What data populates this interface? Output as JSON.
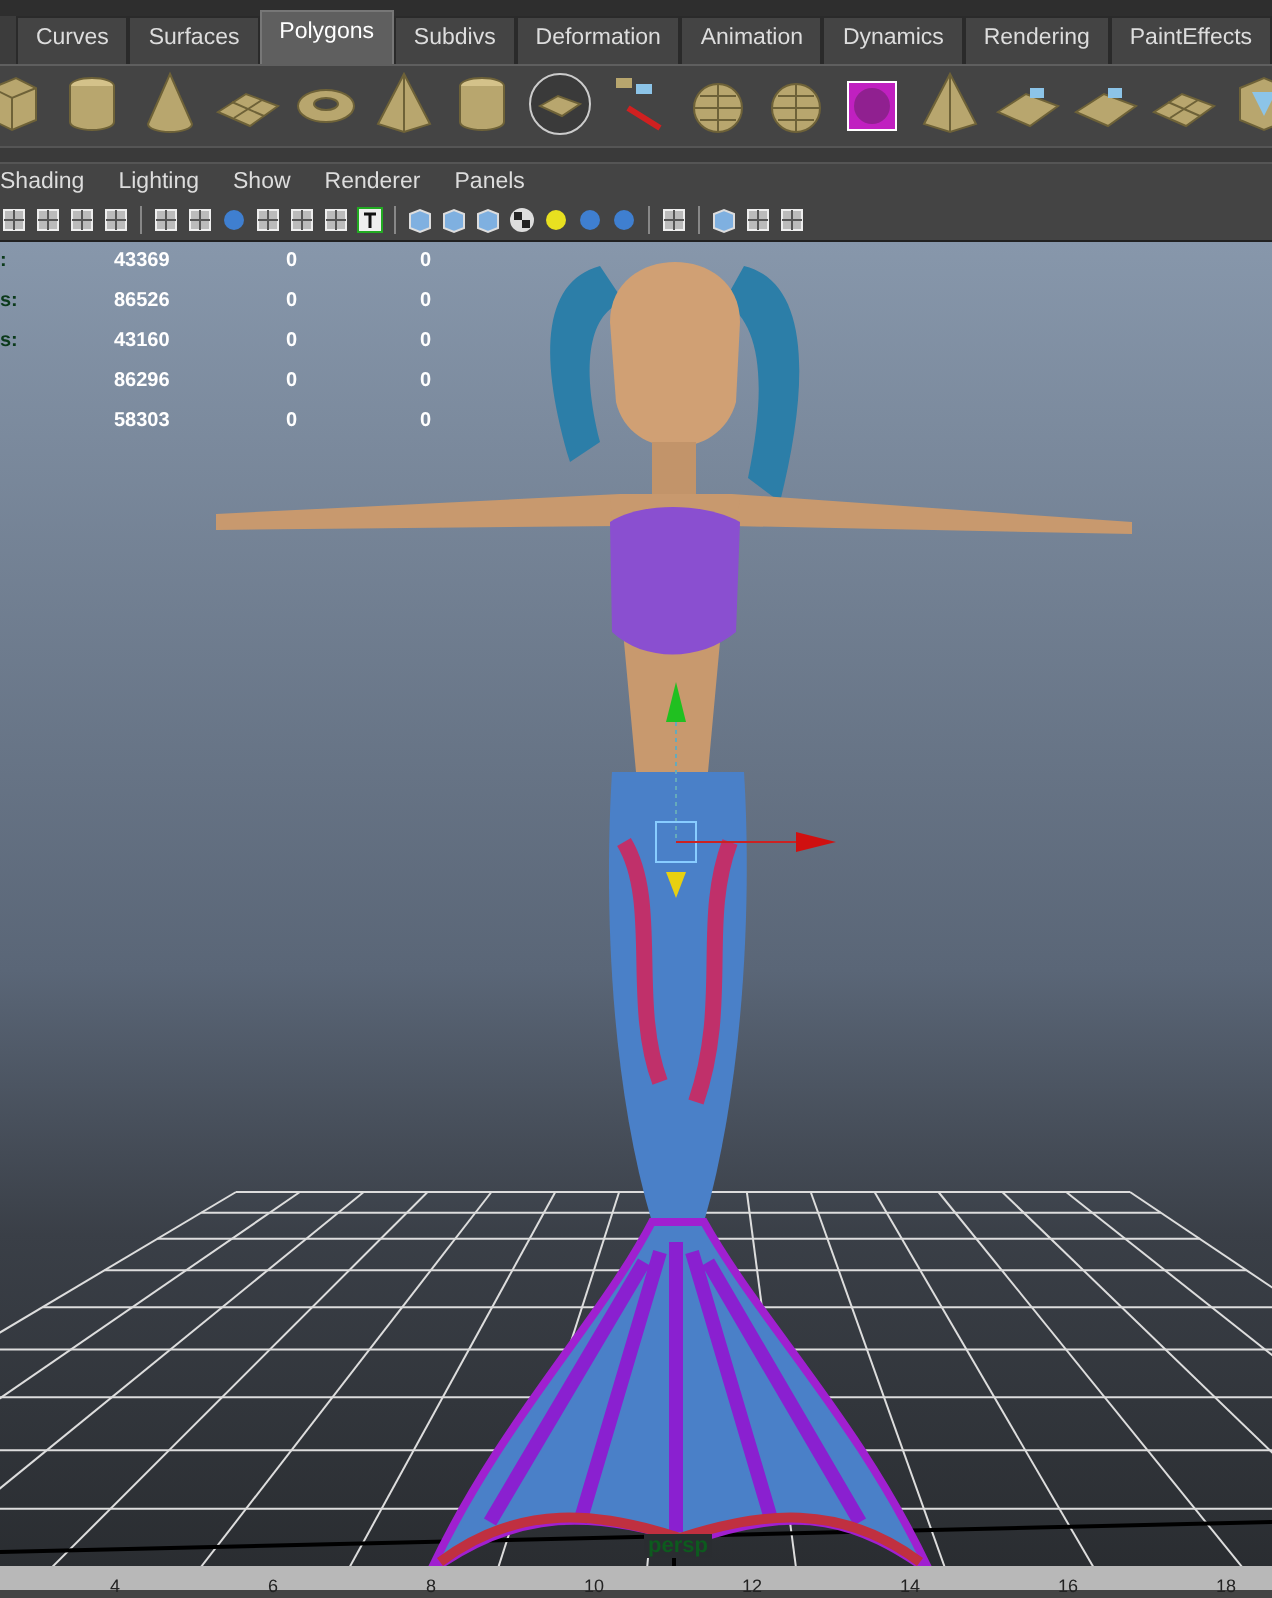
{
  "tabs": [
    {
      "label": "Curves",
      "selected": false
    },
    {
      "label": "Surfaces",
      "selected": false
    },
    {
      "label": "Polygons",
      "selected": true
    },
    {
      "label": "Subdivs",
      "selected": false
    },
    {
      "label": "Deformation",
      "selected": false
    },
    {
      "label": "Animation",
      "selected": false
    },
    {
      "label": "Dynamics",
      "selected": false
    },
    {
      "label": "Rendering",
      "selected": false
    },
    {
      "label": "PaintEffects",
      "selected": false
    }
  ],
  "panel_menu": [
    "Shading",
    "Lighting",
    "Show",
    "Renderer",
    "Panels"
  ],
  "stats": [
    {
      "label": ":",
      "values": [
        "43369",
        "0",
        "0"
      ]
    },
    {
      "label": "s:",
      "values": [
        "86526",
        "0",
        "0"
      ]
    },
    {
      "label": "s:",
      "values": [
        "43160",
        "0",
        "0"
      ]
    },
    {
      "values": [
        "86296",
        "0",
        "0"
      ]
    },
    {
      "values": [
        "58303",
        "0",
        "0"
      ]
    }
  ],
  "camera_label": "persp",
  "timeline_ticks": [
    "4",
    "6",
    "8",
    "10",
    "12",
    "14",
    "16",
    "18"
  ]
}
